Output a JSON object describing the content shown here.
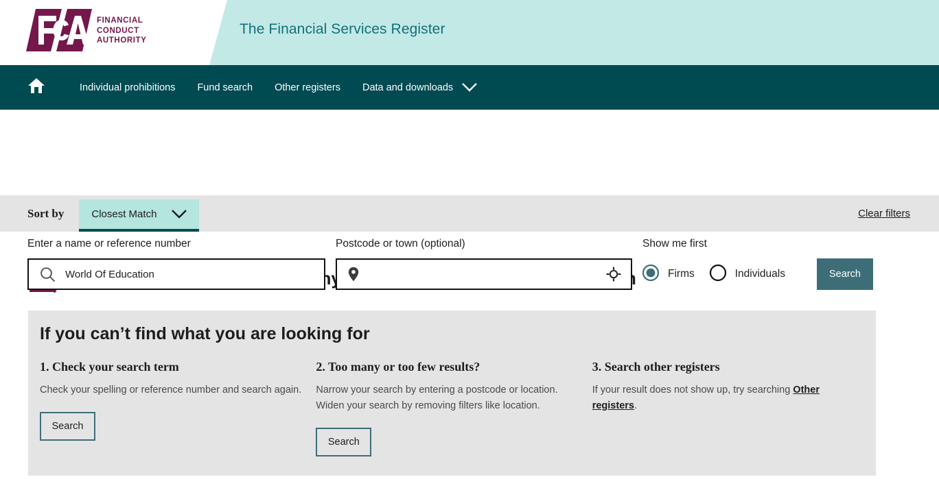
{
  "header": {
    "logo": {
      "mark_text": "FCA",
      "words_line1": "FINANCIAL",
      "words_line2": "CONDUCT",
      "words_line3": "AUTHORITY",
      "brand_color": "#74174a"
    },
    "banner_title": "The Financial Services Register",
    "banner_color": "#c3e9e6",
    "banner_text_color": "#10707c"
  },
  "nav": {
    "background": "#004a52",
    "home_icon": "home-icon",
    "items": [
      {
        "label": "Individual prohibitions",
        "caret": false
      },
      {
        "label": "Fund search",
        "caret": false
      },
      {
        "label": "Other registers",
        "caret": false
      },
      {
        "label": "Data and downloads",
        "caret": true
      }
    ]
  },
  "search": {
    "name_label": "Enter a name or reference number",
    "name_value": "World Of Education",
    "name_placeholder": "Enter a name or reference number",
    "name_icon": "search-icon",
    "postcode_label": "Postcode or town (optional)",
    "postcode_value": "",
    "postcode_placeholder": "",
    "postcode_icon": "map-pin-icon",
    "geolocate_icon": "crosshair-icon",
    "show_me_first_label": "Show me first",
    "radios": [
      {
        "label": "Firms",
        "selected": true
      },
      {
        "label": "Individuals",
        "selected": false
      }
    ],
    "submit_label": "Search",
    "submit_color": "#3d6e78"
  },
  "sort": {
    "label": "Sort by",
    "selected": "Closest Match",
    "caret_icon": "chevron-down-icon",
    "clear_filters_label": "Clear filters",
    "bar_color": "#e4e4e4",
    "select_color": "#b4e5de",
    "select_underline": "#004a52"
  },
  "results": {
    "icon": "document-search-icon",
    "no_results_title": "Unfortunately, we didn't find any results matching your search term"
  },
  "help": {
    "title": "If you can’t find what you are looking for",
    "panel_color": "#e4e4e4",
    "columns": [
      {
        "heading": "1. Check your search term",
        "body_before": "Check your spelling or reference number and search again.",
        "link_text": "",
        "body_after": "",
        "button_label": "Search",
        "has_button": true
      },
      {
        "heading": "2. Too many or too few results?",
        "body_before": "Narrow your search by entering a postcode or location. Widen your search by removing filters like location.",
        "link_text": "",
        "body_after": "",
        "button_label": "Search",
        "has_button": true
      },
      {
        "heading": "3. Search other registers",
        "body_before": "If your result does not show up, try searching ",
        "link_text": "Other registers",
        "body_after": ".",
        "button_label": "",
        "has_button": false
      }
    ]
  }
}
